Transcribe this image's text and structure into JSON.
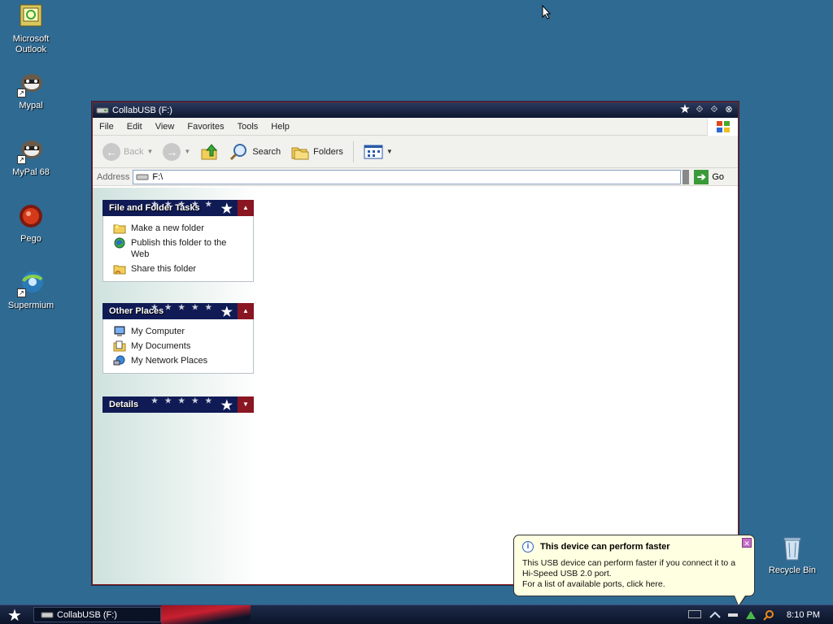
{
  "desktop": {
    "icons": [
      {
        "label_line1": "Microsoft",
        "label_line2": "Outlook",
        "icon": "outlook-icon"
      },
      {
        "label": "Mypal",
        "icon": "raccoon-icon"
      },
      {
        "label": "MyPal 68",
        "icon": "raccoon-icon"
      },
      {
        "label": "Pego",
        "icon": "pego-icon"
      },
      {
        "label": "Supermium",
        "icon": "supermium-icon"
      },
      {
        "label": "Recycle Bin",
        "icon": "recycle-bin-icon"
      }
    ]
  },
  "window": {
    "title": "CollabUSB (F:)",
    "menu": [
      "File",
      "Edit",
      "View",
      "Favorites",
      "Tools",
      "Help"
    ],
    "toolbar": {
      "back": "Back",
      "search": "Search",
      "folders": "Folders"
    },
    "address": {
      "label": "Address",
      "value": "F:\\",
      "go": "Go"
    },
    "panels": {
      "file_tasks": {
        "title": "File and Folder Tasks",
        "items": [
          {
            "line1": "Make a new folder",
            "line2": ""
          },
          {
            "line1": "Publish this folder to the",
            "line2": "Web"
          },
          {
            "line1": "Share this folder",
            "line2": ""
          }
        ]
      },
      "other_places": {
        "title": "Other Places",
        "items": [
          "My Computer",
          "My Documents",
          "My Network Places"
        ]
      },
      "details": {
        "title": "Details"
      }
    }
  },
  "taskbar": {
    "task_label": "CollabUSB (F:)",
    "clock": "8:10 PM"
  },
  "balloon": {
    "title": "This device can perform faster",
    "line1": "This USB device can perform faster if you connect it to a",
    "line2": "Hi-Speed USB 2.0 port.",
    "line3": "For a list of available ports, click here."
  },
  "colors": {
    "desktop": "#2f6a92",
    "panel_header": "#101b55",
    "accent_red": "#8a1622",
    "balloon_bg": "#ffffe1"
  }
}
